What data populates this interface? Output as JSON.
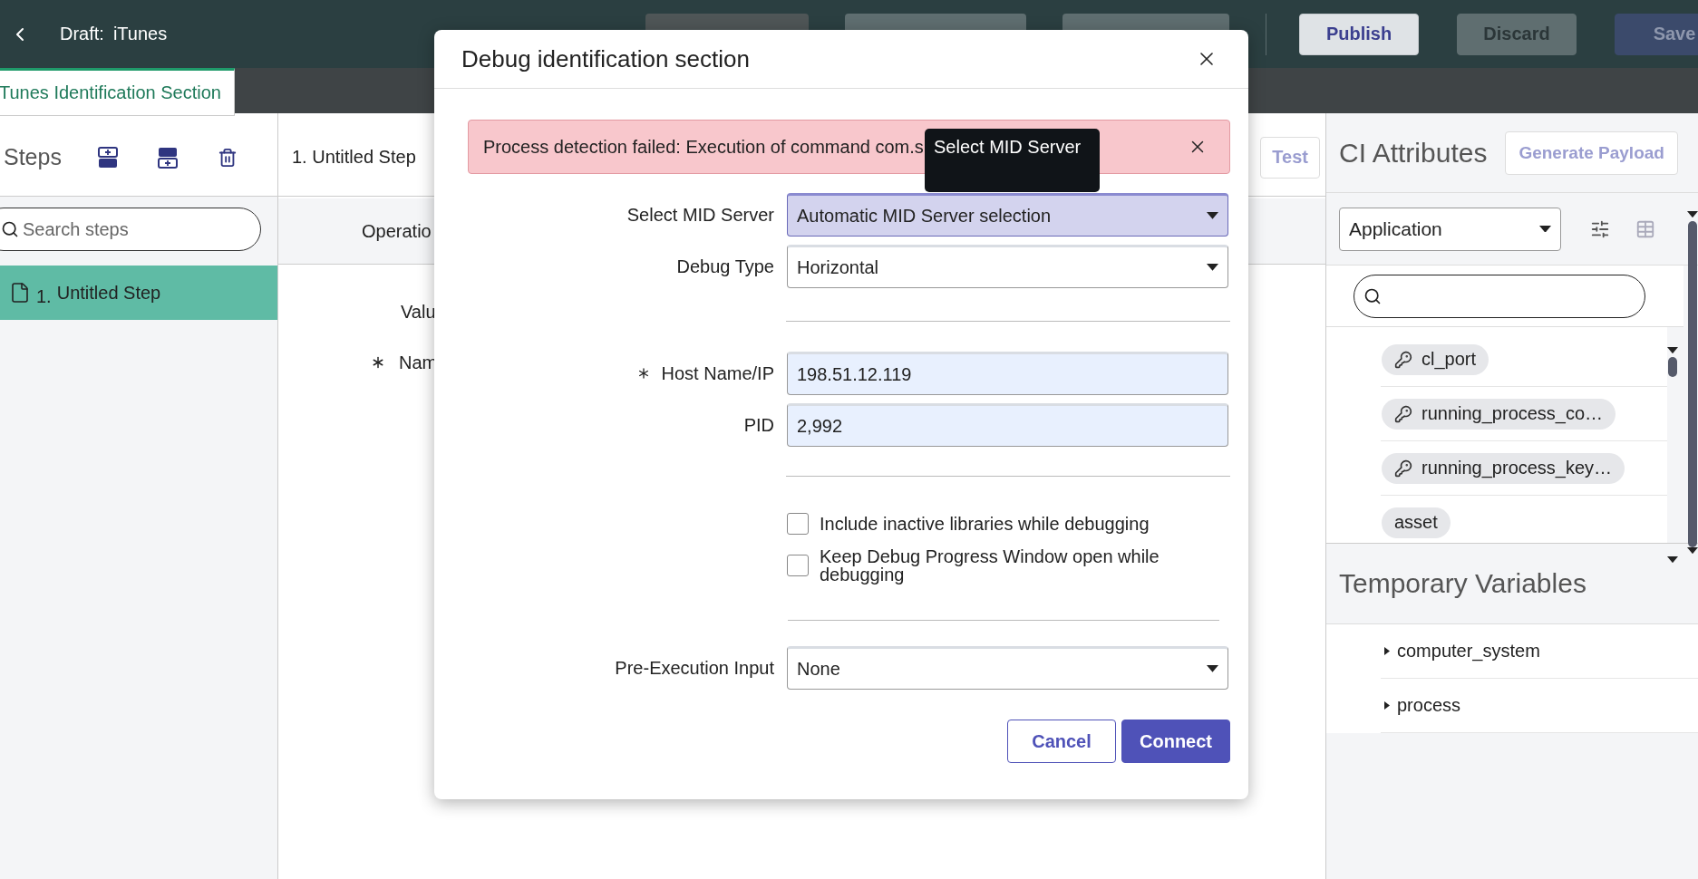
{
  "header": {
    "draft_label": "Draft:",
    "title": "iTunes",
    "buttons": [
      {
        "label": "Publish",
        "kind": "light"
      },
      {
        "label": "Discard",
        "kind": "muted"
      },
      {
        "label": "Save",
        "kind": "dark"
      }
    ]
  },
  "tab": {
    "label": "Tunes Identification Section",
    "selected": true
  },
  "steps": {
    "title": "Steps",
    "search_placeholder": "Search steps",
    "items": [
      {
        "number": "1.",
        "label": "Untitled Step",
        "selected": true
      }
    ]
  },
  "editor": {
    "step_title": "1. Untitled Step",
    "test_button": "Test",
    "column_header": "Operatio",
    "fields": [
      {
        "label": "Valu",
        "required": false
      },
      {
        "label": "Nam",
        "required": true
      }
    ]
  },
  "ci_panel": {
    "title": "CI Attributes",
    "generate_button": {
      "label": "Generate Payload",
      "disabled": true
    },
    "class_select": "Application",
    "attributes": [
      {
        "name": "cl_port",
        "key": true
      },
      {
        "name": "running_process_co…",
        "key": true
      },
      {
        "name": "running_process_key…",
        "key": true
      },
      {
        "name": "asset",
        "key": false
      }
    ],
    "temp_title": "Temporary Variables",
    "variables": [
      {
        "name": "computer_system",
        "expanded": false
      },
      {
        "name": "process",
        "expanded": false
      }
    ]
  },
  "dialog": {
    "title": "Debug identification section",
    "alert": {
      "message": "Process detection failed: Execution of command com.s"
    },
    "tooltip": "Select MID Server",
    "sections": [
      {
        "kind": "fields",
        "fields": [
          {
            "kind": "select",
            "label": "Select MID Server",
            "value": "Automatic MID Server selection",
            "required": false,
            "focused": true
          },
          {
            "kind": "select",
            "label": "Debug Type",
            "value": "Horizontal",
            "required": false,
            "focused": false
          }
        ]
      },
      {
        "kind": "fields",
        "fields": [
          {
            "kind": "text",
            "label": "Host Name/IP",
            "value": "198.51.12.119",
            "required": true,
            "focused": false
          },
          {
            "kind": "text",
            "label": "PID",
            "value": "2,992",
            "required": false,
            "focused": false
          }
        ]
      },
      {
        "kind": "checkboxes",
        "options": [
          {
            "label": "Include inactive libraries while debugging",
            "checked": false
          },
          {
            "label": "Keep Debug Progress Window open while debugging",
            "checked": false
          }
        ]
      },
      {
        "kind": "fields",
        "fields": [
          {
            "kind": "select",
            "label": "Pre-Execution Input",
            "value": "None",
            "required": false,
            "focused": false
          }
        ]
      }
    ],
    "buttons": [
      {
        "label": "Cancel",
        "kind": "secondary"
      },
      {
        "label": "Connect",
        "kind": "primary"
      }
    ]
  }
}
